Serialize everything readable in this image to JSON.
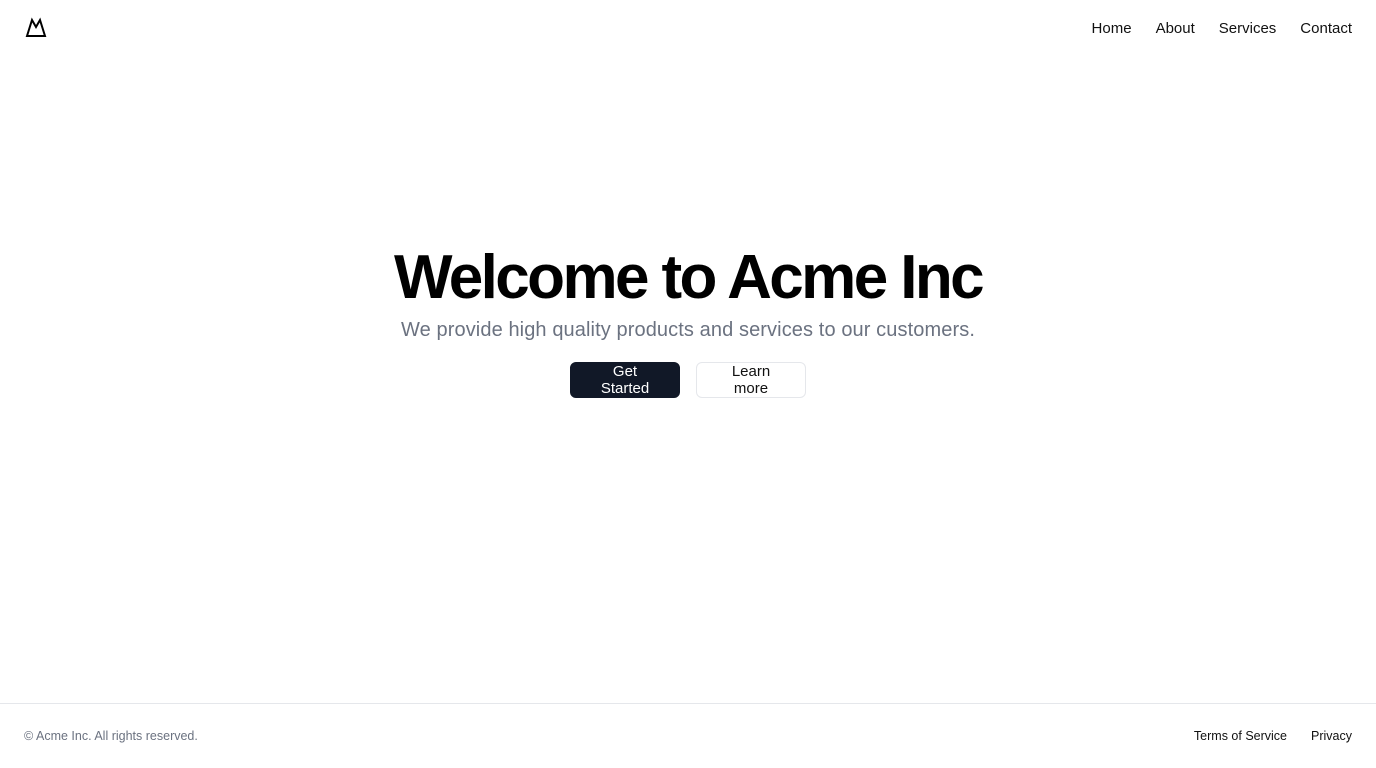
{
  "header": {
    "logo_icon": "mountain-icon",
    "nav": [
      {
        "label": "Home"
      },
      {
        "label": "About"
      },
      {
        "label": "Services"
      },
      {
        "label": "Contact"
      }
    ]
  },
  "hero": {
    "title": "Welcome to Acme Inc",
    "subtitle": "We provide high quality products and services to our customers.",
    "primary_button": "Get Started",
    "secondary_button": "Learn more"
  },
  "footer": {
    "copyright": "© Acme Inc. All rights reserved.",
    "links": [
      {
        "label": "Terms of Service"
      },
      {
        "label": "Privacy"
      }
    ]
  },
  "colors": {
    "primary_button_bg": "#111827",
    "subtitle_text": "#6b7280",
    "border": "#e5e7eb"
  }
}
